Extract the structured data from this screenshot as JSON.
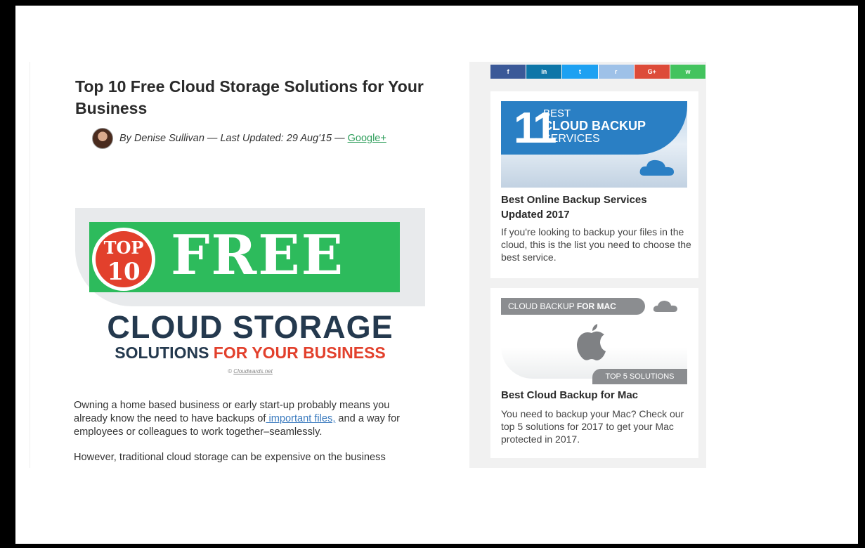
{
  "article": {
    "title": "Top 10 Free Cloud Storage Solutions for Your Business",
    "byline": "By Denise Sullivan — Last Updated: 29 Aug'15 —",
    "google_plus": "Google+",
    "hero": {
      "top_badge_line1": "TOP",
      "top_badge_line2": "10",
      "big_word": "FREE",
      "line1": "CLOUD STORAGE",
      "line2_a": "SOLUTIONS",
      "line2_b": "FOR YOUR BUSINESS",
      "credit_prefix": "©",
      "credit_link": "Cloudwards.net",
      "colors": {
        "green": "#2dbb5c",
        "red": "#e2402c",
        "navy": "#24394e"
      }
    },
    "para1_before": "Owning a home based business or early start-up probably means you already know the need to have backups of",
    "para1_link": " important files,",
    "para1_after": " and a way for employees or colleagues to work together–seamlessly.",
    "para2": "However, traditional cloud storage can be expensive on the business"
  },
  "share_buttons": [
    {
      "icon": "facebook-icon",
      "glyph": "f",
      "color": "#3b5998"
    },
    {
      "icon": "linkedin-icon",
      "glyph": "in",
      "color": "#0e76a8"
    },
    {
      "icon": "twitter-icon",
      "glyph": "t",
      "color": "#1da1f2"
    },
    {
      "icon": "reddit-icon",
      "glyph": "r",
      "color": "#9ec1e8"
    },
    {
      "icon": "googleplus-icon",
      "glyph": "G+",
      "color": "#dd4b39"
    },
    {
      "icon": "whatsapp-icon",
      "glyph": "w",
      "color": "#43c35e"
    }
  ],
  "cards": [
    {
      "img_number": "11",
      "img_line1": "BEST",
      "img_line2": "CLOUD BACKUP",
      "img_line3": "SERVICES",
      "title": "Best Online Backup Services Updated 2017",
      "desc": "If you're looking to backup your files in the cloud, this is the list you need to choose the best service."
    },
    {
      "img_head_a": "CLOUD BACKUP ",
      "img_head_b": "FOR MAC",
      "img_foot": "TOP 5 SOLUTIONS",
      "title": "Best Cloud Backup for Mac",
      "desc": "You need to backup your Mac? Check our top 5 solutions for 2017 to get your Mac protected in 2017."
    }
  ]
}
